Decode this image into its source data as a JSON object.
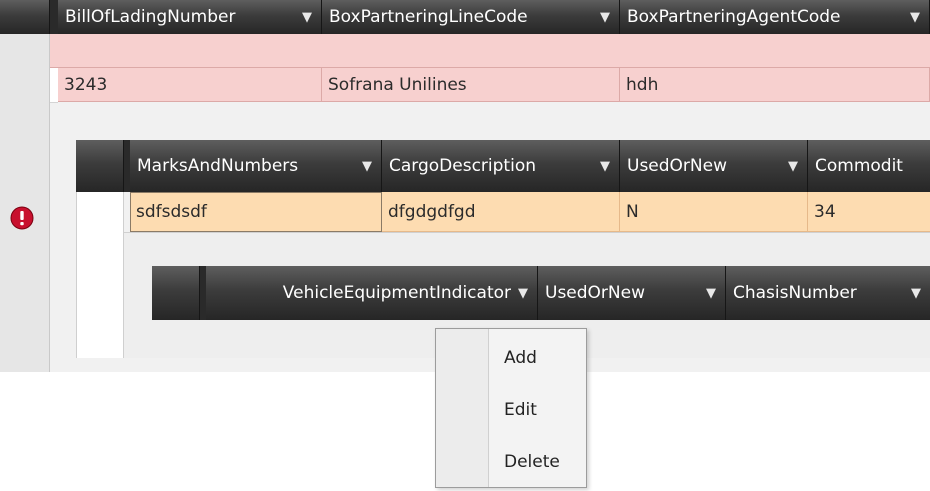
{
  "outer_grid": {
    "columns": [
      "BillOfLadingNumber",
      "BoxPartneringLineCode",
      "BoxPartneringAgentCode"
    ],
    "row": [
      "3243",
      "Sofrana Unilines",
      "hdh"
    ],
    "row_error_icon": "error-exclamation-icon"
  },
  "cargo_grid": {
    "columns": [
      "MarksAndNumbers",
      "CargoDescription",
      "UsedOrNew",
      "Commodit"
    ],
    "row": [
      "sdfsdsdf",
      "dfgdgdfgd",
      "N",
      "34"
    ]
  },
  "vehicle_grid": {
    "columns": [
      "VehicleEquipmentIndicator",
      "UsedOrNew",
      "ChasisNumber"
    ]
  },
  "context_menu": {
    "items": [
      "Add",
      "Edit",
      "Delete"
    ]
  },
  "icons": {
    "filter": "filter-funnel-icon",
    "error": "error-exclamation-icon"
  },
  "colors": {
    "header": "#3c3c3c",
    "error_row": "#f7d0cf",
    "cargo_row": "#fddcb1",
    "error_icon": "#c8102e"
  }
}
